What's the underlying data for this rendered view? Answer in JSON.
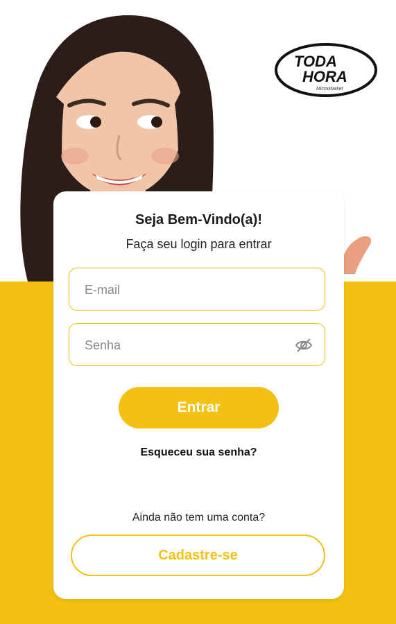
{
  "logo": {
    "line1": "TODA",
    "line2": "HORA",
    "tagline": "MicroMarket"
  },
  "login": {
    "title": "Seja Bem-Vindo(a)!",
    "subtitle": "Faça seu login para entrar",
    "email_placeholder": "E-mail",
    "password_placeholder": "Senha",
    "submit_label": "Entrar",
    "forgot_label": "Esqueceu sua senha?",
    "no_account_text": "Ainda não tem uma conta?",
    "register_label": "Cadastre-se"
  },
  "colors": {
    "accent": "#f2c111",
    "card": "#ffffff"
  },
  "icons": {
    "password_toggle": "eye-off-icon"
  }
}
